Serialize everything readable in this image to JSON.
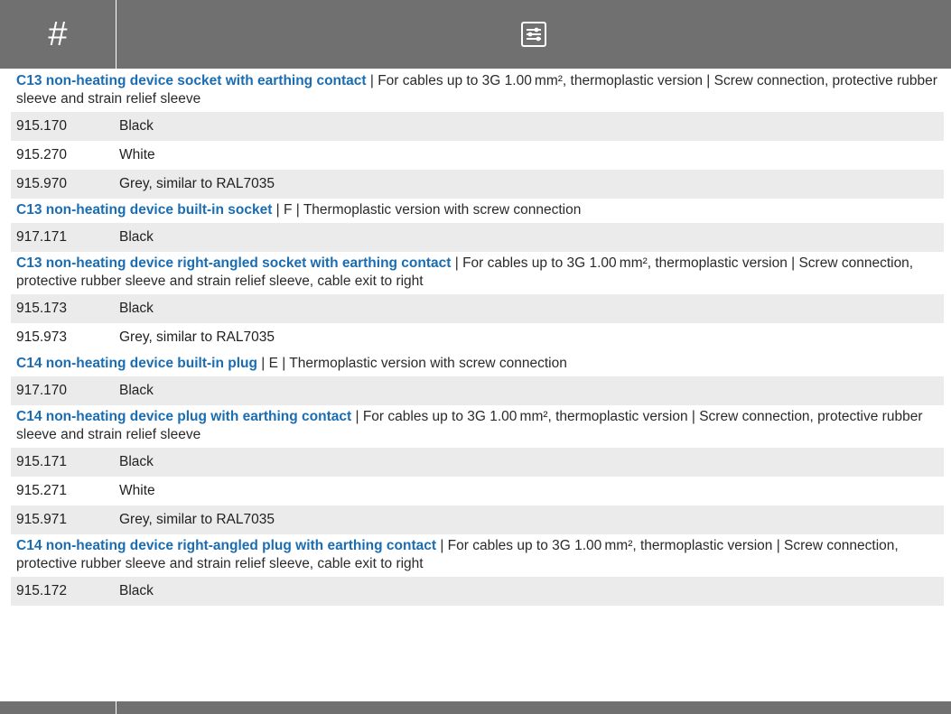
{
  "header": {
    "number_label": "#",
    "filter_icon": "sliders-icon",
    "background_color": "#707070"
  },
  "accent_color": "#1a6db2",
  "groups": [
    {
      "title": "C13 non-heating device socket with earthing contact",
      "description": " | For cables up to 3G 1.00 mm², thermoplastic version | Screw connection, protective rubber sleeve and strain relief sleeve",
      "rows": [
        {
          "code": "915.170",
          "color": "Black"
        },
        {
          "code": "915.270",
          "color": "White"
        },
        {
          "code": "915.970",
          "color": "Grey, similar to RAL7035"
        }
      ]
    },
    {
      "title": "C13 non-heating device built-in socket",
      "description": " | F | Thermoplastic version with screw connection",
      "rows": [
        {
          "code": "917.171",
          "color": "Black"
        }
      ]
    },
    {
      "title": "C13 non-heating device right-angled socket with earthing contact",
      "description": " | For cables up to 3G 1.00 mm², thermoplastic version | Screw connection, protective rubber sleeve and strain relief sleeve, cable exit to right",
      "rows": [
        {
          "code": "915.173",
          "color": "Black"
        },
        {
          "code": "915.973",
          "color": "Grey, similar to RAL7035"
        }
      ]
    },
    {
      "title": "C14 non-heating device built-in plug",
      "description": " | E | Thermoplastic version with screw connection",
      "rows": [
        {
          "code": "917.170",
          "color": "Black"
        }
      ]
    },
    {
      "title": "C14 non-heating device plug with earthing contact",
      "description": " | For cables up to 3G 1.00 mm², thermoplastic version | Screw connection, protective rubber sleeve and strain relief sleeve",
      "rows": [
        {
          "code": "915.171",
          "color": "Black"
        },
        {
          "code": "915.271",
          "color": "White"
        },
        {
          "code": "915.971",
          "color": "Grey, similar to RAL7035"
        }
      ]
    },
    {
      "title": "C14 non-heating device right-angled plug with earthing contact",
      "description": " | For cables up to 3G 1.00 mm², thermoplastic version | Screw connection, protective rubber sleeve and strain relief sleeve, cable exit to right",
      "rows": [
        {
          "code": "915.172",
          "color": "Black"
        }
      ]
    }
  ]
}
